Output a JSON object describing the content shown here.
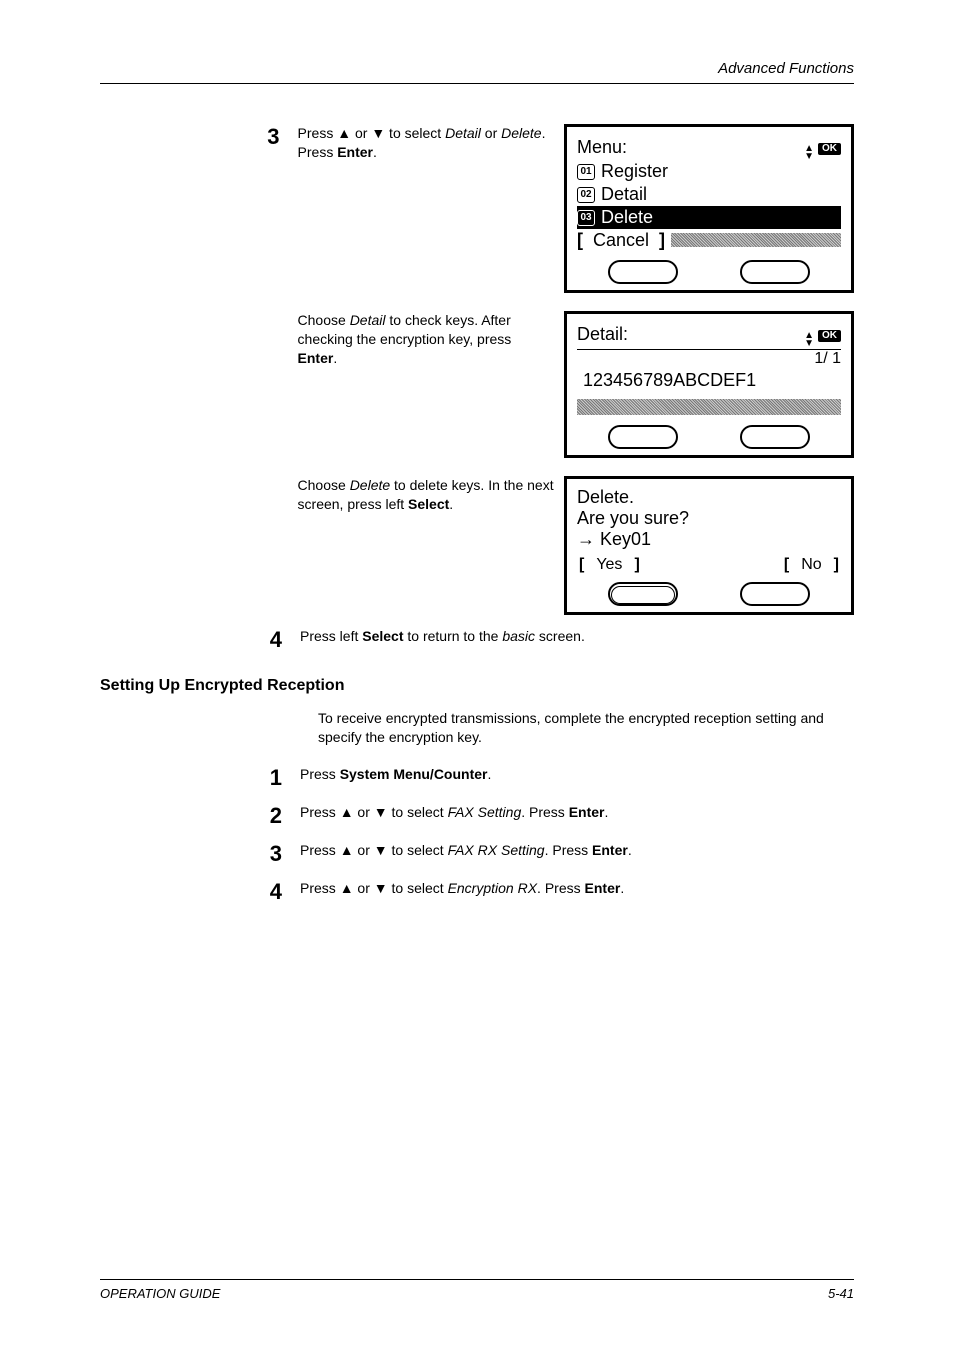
{
  "header": {
    "section": "Advanced Functions"
  },
  "step3": {
    "num": "3",
    "text_pre": "Press ",
    "text_mid": " or ",
    "text_post": " to select ",
    "italic1": "Detail",
    "or": " or ",
    "italic2": "Delete",
    "dot": ". Press ",
    "enter": "Enter",
    "dot2": "."
  },
  "lcd_menu": {
    "title": "Menu",
    "items": [
      {
        "num": "01",
        "label": "Register"
      },
      {
        "num": "02",
        "label": "Detail"
      },
      {
        "num": "03",
        "label": "Delete"
      }
    ],
    "cancel": "Cancel"
  },
  "detail_block": {
    "line1": "Choose ",
    "italic": "Detail",
    "line1b": " to check keys. After checking the encryption key, press ",
    "enter": "Enter",
    "dot": "."
  },
  "lcd_detail": {
    "title": "Detail",
    "page": "1/ 1",
    "value": "123456789ABCDEF1"
  },
  "delete_block": {
    "line1": "Choose ",
    "italic": "Delete",
    "line1b": " to delete keys. In the next screen, press left ",
    "select": "Select",
    "dot": "."
  },
  "lcd_delete": {
    "l1": "Delete.",
    "l2": "Are you sure?",
    "l3_arrow": "→",
    "l3": "Key01",
    "yes": "Yes",
    "no": "No"
  },
  "step4": {
    "num": "4",
    "pre": "Press left ",
    "select": "Select",
    "mid": " to return to the ",
    "basic": "basic",
    "post": " screen."
  },
  "h2": "Setting Up Encrypted Reception",
  "intro": "To receive encrypted transmissions, complete the encrypted reception setting and specify the encryption key.",
  "s1": {
    "num": "1",
    "pre": "Press ",
    "bold": "System Menu/Counter",
    "post": "."
  },
  "s2": {
    "num": "2",
    "pre": "Press ",
    "mid": " or ",
    "to": " to select ",
    "it": "FAX Setting",
    "dot": ". Press ",
    "enter": "Enter",
    "dot2": "."
  },
  "s3": {
    "num": "3",
    "pre": "Press ",
    "mid": " or ",
    "to": " to select ",
    "it": "FAX RX Setting",
    "dot": ". Press ",
    "enter": "Enter",
    "dot2": "."
  },
  "s4": {
    "num": "4",
    "pre": "Press ",
    "mid": " or ",
    "to": " to select ",
    "it": "Encryption RX",
    "dot": ". Press ",
    "enter": "Enter",
    "dot2": "."
  },
  "footer": {
    "guide": "OPERATION GUIDE",
    "page": "5-41"
  },
  "tri_up": "▲",
  "tri_down": "▼",
  "colon": ":",
  "ok": "OK"
}
